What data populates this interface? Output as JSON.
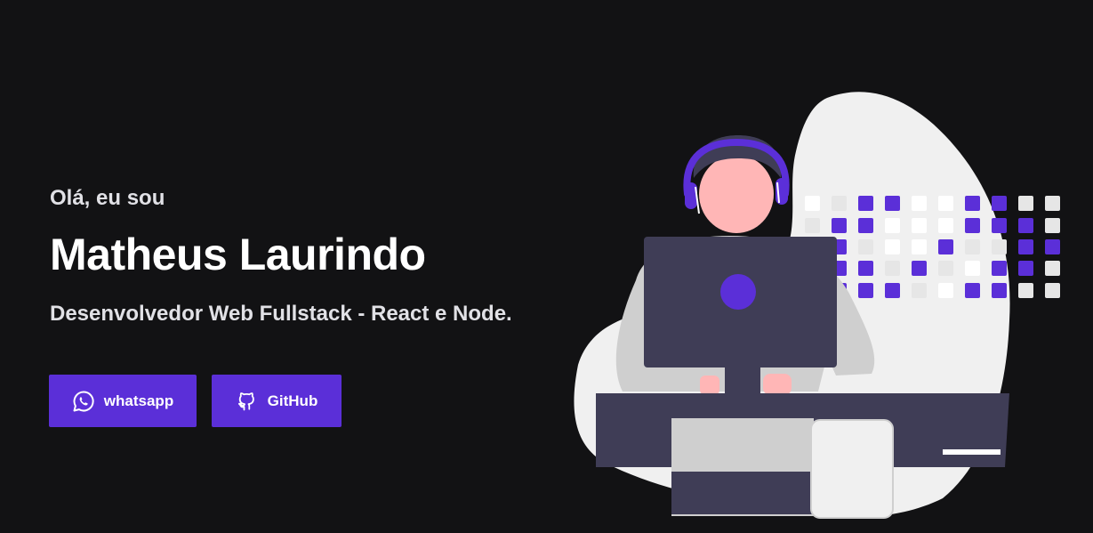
{
  "hero": {
    "greeting": "Olá, eu sou",
    "name": "Matheus Laurindo",
    "role": "Desenvolvedor Web Fullstack - React e Node."
  },
  "actions": {
    "whatsapp_label": "whatsapp",
    "github_label": "GitHub"
  },
  "icons": {
    "whatsapp": "whatsapp-icon",
    "github": "github-icon"
  },
  "colors": {
    "background": "#121214",
    "accent": "#5b2fd8",
    "text": "#e1e1e6"
  }
}
